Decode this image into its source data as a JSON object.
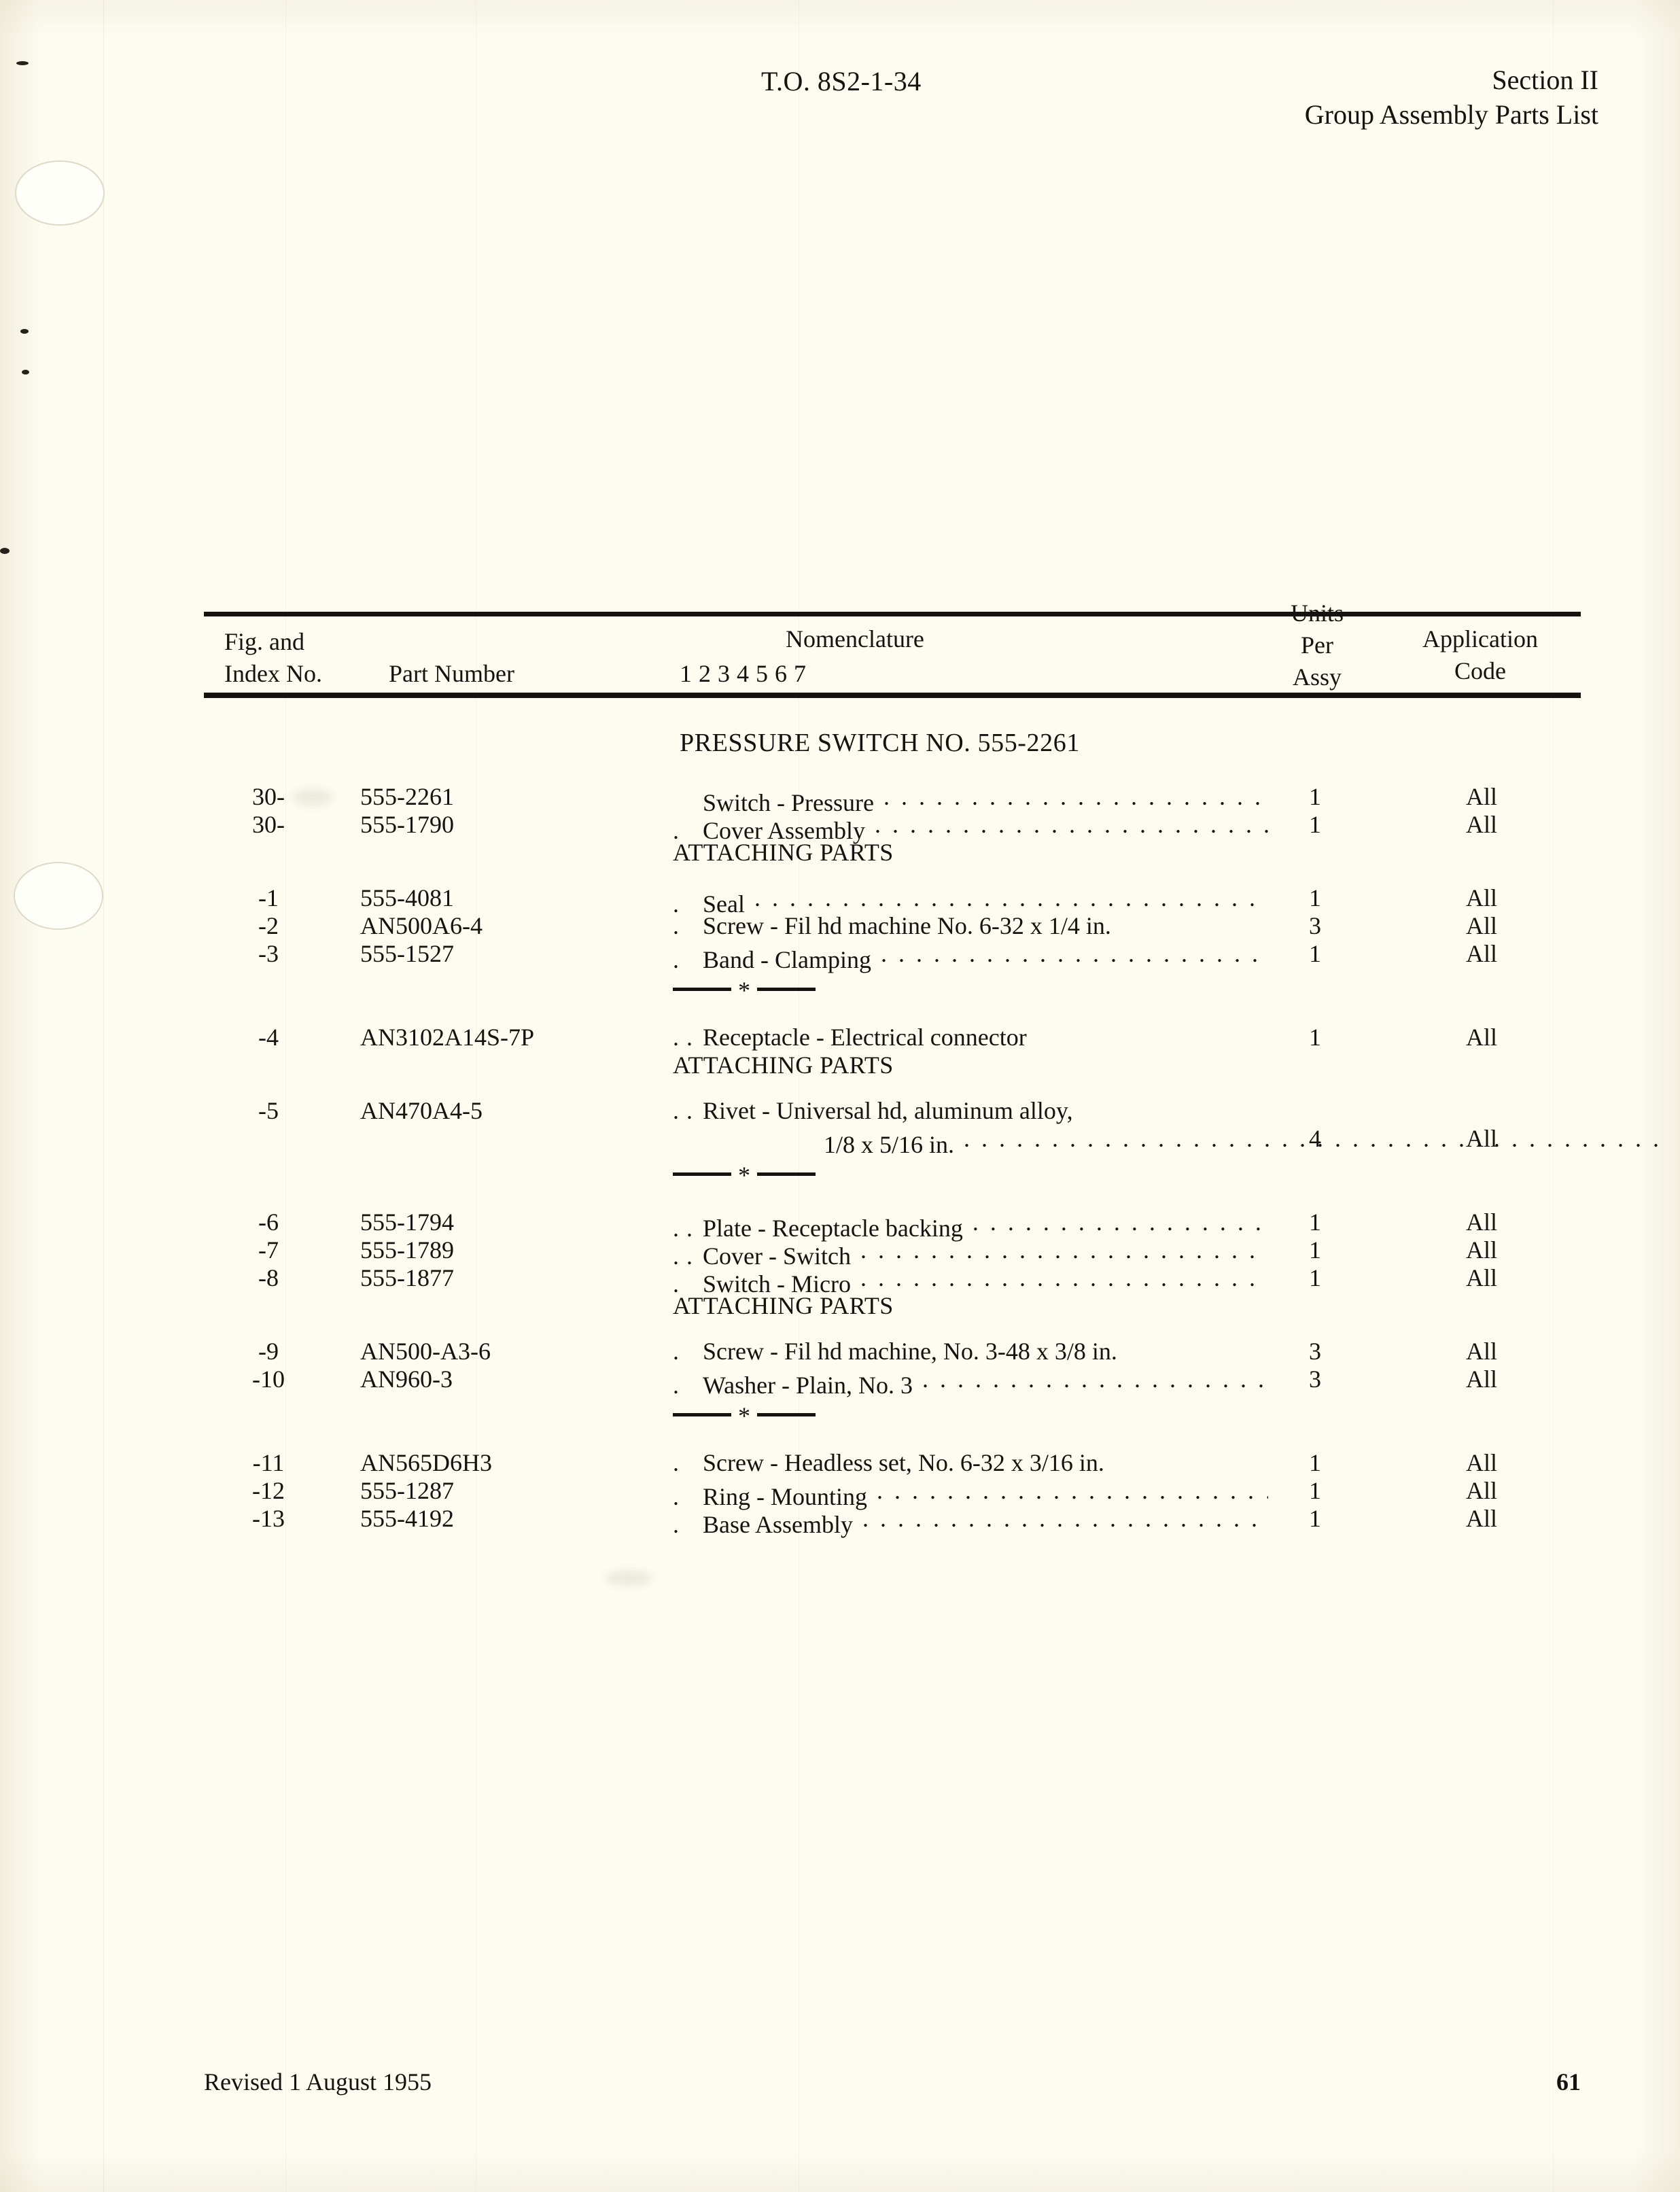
{
  "header": {
    "technical_order": "T.O. 8S2-1-34",
    "section": "Section II",
    "section_subtitle": "Group Assembly Parts List"
  },
  "table": {
    "columns": {
      "fig_index_line1": "Fig. and",
      "fig_index_line2": "Index No.",
      "part_number": "Part Number",
      "nomenclature": "Nomenclature",
      "indent_digits": "1  2  3  4  5  6  7",
      "units_line1": "Units",
      "units_line2": "Per",
      "units_line3": "Assy",
      "application_line1": "Application",
      "application_line2": "Code"
    },
    "group_title": "PRESSURE SWITCH NO. 555-2261",
    "attaching_parts_label": "ATTACHING PARTS",
    "rows": [
      {
        "kind": "item",
        "index": "30-",
        "part_number": "555-2261",
        "dots": "",
        "nomenclature": "Switch - Pressure",
        "leader": true,
        "units": "1",
        "application": "All"
      },
      {
        "kind": "item",
        "index": "30-",
        "part_number": "555-1790",
        "dots": ".",
        "nomenclature": "Cover Assembly",
        "leader": true,
        "units": "1",
        "application": "All"
      },
      {
        "kind": "subhead",
        "text": "ATTACHING PARTS"
      },
      {
        "kind": "gap"
      },
      {
        "kind": "item",
        "index": "-1",
        "part_number": "555-4081",
        "dots": ".",
        "nomenclature": "Seal",
        "leader": true,
        "units": "1",
        "application": "All"
      },
      {
        "kind": "item",
        "index": "-2",
        "part_number": "AN500A6-4",
        "dots": ".",
        "nomenclature": "Screw - Fil hd machine No. 6-32 x 1/4 in.",
        "leader": false,
        "units": "3",
        "application": "All"
      },
      {
        "kind": "item",
        "index": "-3",
        "part_number": "555-1527",
        "dots": ".",
        "nomenclature": "Band - Clamping",
        "leader": true,
        "units": "1",
        "application": "All"
      },
      {
        "kind": "star"
      },
      {
        "kind": "item",
        "index": "-4",
        "part_number": "AN3102A14S-7P",
        "dots": ". .",
        "nomenclature": "Receptacle - Electrical connector",
        "leader": false,
        "units": "1",
        "application": "All"
      },
      {
        "kind": "subhead",
        "text": "ATTACHING PARTS"
      },
      {
        "kind": "gap"
      },
      {
        "kind": "item",
        "index": "-5",
        "part_number": "AN470A4-5",
        "dots": ". .",
        "nomenclature": "Rivet - Universal hd, aluminum alloy,",
        "leader": false,
        "units": "",
        "application": ""
      },
      {
        "kind": "continuation",
        "nomenclature": "1/8 x 5/16 in.",
        "leader": true,
        "units": "4",
        "application": "All"
      },
      {
        "kind": "star"
      },
      {
        "kind": "item",
        "index": "-6",
        "part_number": "555-1794",
        "dots": ". .",
        "nomenclature": "Plate - Receptacle backing",
        "leader": true,
        "units": "1",
        "application": "All"
      },
      {
        "kind": "item",
        "index": "-7",
        "part_number": "555-1789",
        "dots": ". .",
        "nomenclature": "Cover - Switch",
        "leader": true,
        "units": "1",
        "application": "All"
      },
      {
        "kind": "item",
        "index": "-8",
        "part_number": "555-1877",
        "dots": ".",
        "nomenclature": "Switch - Micro",
        "leader": true,
        "units": "1",
        "application": "All"
      },
      {
        "kind": "subhead",
        "text": "ATTACHING PARTS"
      },
      {
        "kind": "gap"
      },
      {
        "kind": "item",
        "index": "-9",
        "part_number": "AN500-A3-6",
        "dots": ".",
        "nomenclature": "Screw - Fil hd machine, No. 3-48 x 3/8 in.",
        "leader": false,
        "units": "3",
        "application": "All"
      },
      {
        "kind": "item",
        "index": "-10",
        "part_number": "AN960-3",
        "dots": ".",
        "nomenclature": "Washer - Plain, No. 3",
        "leader": true,
        "units": "3",
        "application": "All"
      },
      {
        "kind": "star"
      },
      {
        "kind": "item",
        "index": "-11",
        "part_number": "AN565D6H3",
        "dots": ".",
        "nomenclature": "Screw - Headless set, No. 6-32 x 3/16 in.",
        "leader": false,
        "units": "1",
        "application": "All"
      },
      {
        "kind": "item",
        "index": "-12",
        "part_number": "555-1287",
        "dots": ".",
        "nomenclature": "Ring - Mounting",
        "leader": true,
        "units": "1",
        "application": "All"
      },
      {
        "kind": "item",
        "index": "-13",
        "part_number": "555-4192",
        "dots": ".",
        "nomenclature": "Base Assembly",
        "leader": true,
        "units": "1",
        "application": "All"
      }
    ]
  },
  "footer": {
    "revision": "Revised 1 August 1955",
    "page_number": "61"
  }
}
